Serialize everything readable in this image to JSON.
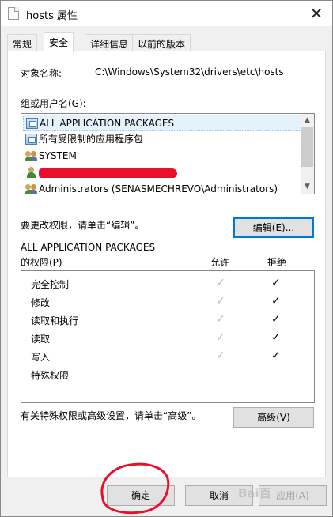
{
  "window": {
    "title": "hosts 属性",
    "close_glyph": "✕"
  },
  "tabs": [
    {
      "label": "常规"
    },
    {
      "label": "安全"
    },
    {
      "label": "详细信息"
    },
    {
      "label": "以前的版本"
    }
  ],
  "security": {
    "object_label": "对象名称:",
    "object_value": "C:\\Windows\\System32\\drivers\\etc\\hosts",
    "group_label": "组或用户名(G):",
    "groups": [
      {
        "name": "ALL APPLICATION PACKAGES",
        "icon": "package-icon",
        "selected": true
      },
      {
        "name": "所有受限制的应用程序包",
        "icon": "package-icon",
        "selected": false
      },
      {
        "name": "SYSTEM",
        "icon": "group-icon",
        "selected": false
      },
      {
        "name": "",
        "icon": "user-icon",
        "selected": false,
        "redacted": true
      },
      {
        "name": "Administrators (SENASMECHREVO\\Administrators)",
        "icon": "group-icon",
        "selected": false
      }
    ],
    "edit_hint": "要更改权限，请单击“编辑”。",
    "edit_button": "编辑(E)...",
    "perm_for": "ALL APPLICATION PACKAGES",
    "perm_label": "的权限(P)",
    "allow_header": "允许",
    "deny_header": "拒绝",
    "permissions": [
      {
        "name": "完全控制",
        "allow": true,
        "deny": true
      },
      {
        "name": "修改",
        "allow": true,
        "deny": true
      },
      {
        "name": "读取和执行",
        "allow": true,
        "deny": true
      },
      {
        "name": "读取",
        "allow": true,
        "deny": true
      },
      {
        "name": "写入",
        "allow": true,
        "deny": true
      },
      {
        "name": "特殊权限",
        "allow": false,
        "deny": false
      }
    ],
    "advanced_hint": "有关特殊权限或高级设置，请单击“高级”。",
    "advanced_button": "高级(V)"
  },
  "footer": {
    "ok": "确定",
    "cancel": "取消",
    "apply": "应用(A)"
  },
  "check_glyph": "✓",
  "colors": {
    "annotation": "#e8102a",
    "focus": "#0078d7"
  }
}
